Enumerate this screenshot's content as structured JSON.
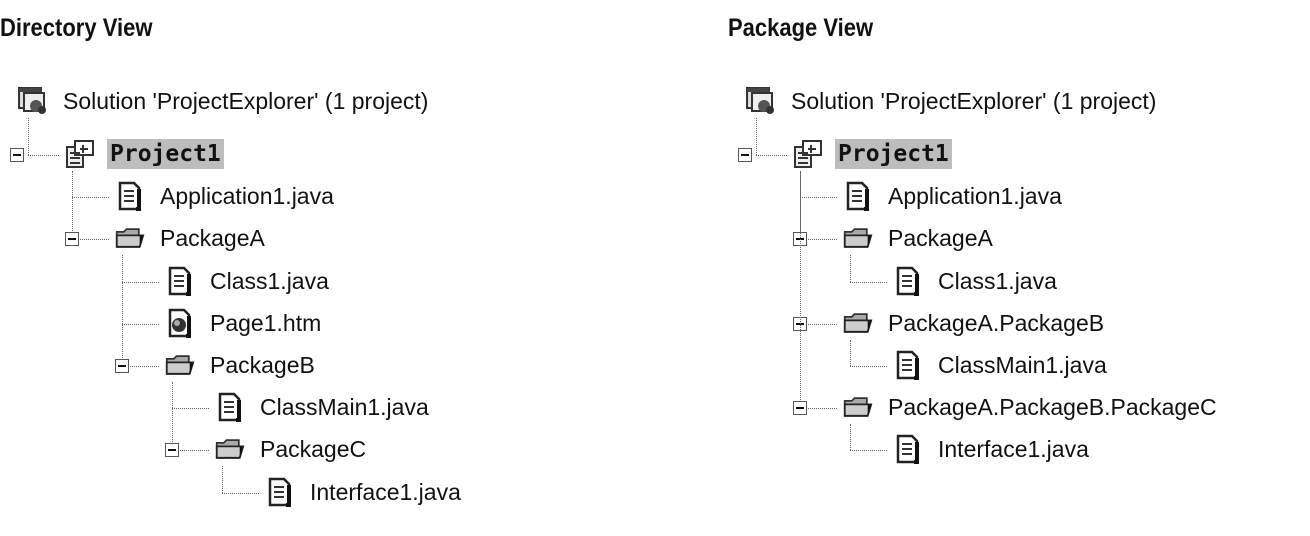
{
  "panels": [
    {
      "title": "Directory View",
      "nodes": [
        {
          "label": "Solution 'ProjectExplorer' (1 project)",
          "level": 0,
          "icon": "solution-icon"
        },
        {
          "label": "Project1",
          "level": 1,
          "icon": "project-icon",
          "expanded": true,
          "selected": true,
          "parent": 0
        },
        {
          "label": "Application1.java",
          "level": 2,
          "icon": "java-file-icon",
          "parent": 1
        },
        {
          "label": "PackageA",
          "level": 2,
          "icon": "folder-icon",
          "expanded": true,
          "parent": 1
        },
        {
          "label": "Class1.java",
          "level": 3,
          "icon": "java-file-icon",
          "parent": 3
        },
        {
          "label": "Page1.htm",
          "level": 3,
          "icon": "html-file-icon",
          "parent": 3
        },
        {
          "label": "PackageB",
          "level": 3,
          "icon": "folder-icon",
          "expanded": true,
          "parent": 3
        },
        {
          "label": "ClassMain1.java",
          "level": 4,
          "icon": "java-file-icon",
          "parent": 6
        },
        {
          "label": "PackageC",
          "level": 4,
          "icon": "folder-icon",
          "expanded": true,
          "parent": 6
        },
        {
          "label": "Interface1.java",
          "level": 5,
          "icon": "java-file-icon",
          "parent": 8
        }
      ]
    },
    {
      "title": "Package View",
      "nodes": [
        {
          "label": "Solution 'ProjectExplorer' (1 project)",
          "level": 0,
          "icon": "solution-icon"
        },
        {
          "label": "Project1",
          "level": 1,
          "icon": "project-icon",
          "expanded": true,
          "selected": true,
          "parent": 0
        },
        {
          "label": "Application1.java",
          "level": 2,
          "icon": "java-file-icon",
          "parent": 1
        },
        {
          "label": "PackageA",
          "level": 2,
          "icon": "folder-icon",
          "expanded": true,
          "parent": 1
        },
        {
          "label": "Class1.java",
          "level": 3,
          "icon": "java-file-icon",
          "parent": 3
        },
        {
          "label": "PackageA.PackageB",
          "level": 2,
          "icon": "folder-icon",
          "expanded": true,
          "parent": 1
        },
        {
          "label": "ClassMain1.java",
          "level": 3,
          "icon": "java-file-icon",
          "parent": 5
        },
        {
          "label": "PackageA.PackageB.PackageC",
          "level": 2,
          "icon": "folder-icon",
          "expanded": true,
          "parent": 1
        },
        {
          "label": "Interface1.java",
          "level": 3,
          "icon": "java-file-icon",
          "parent": 7
        }
      ]
    }
  ],
  "colors": {
    "selection": "#bdbdbd",
    "text": "#111111"
  }
}
